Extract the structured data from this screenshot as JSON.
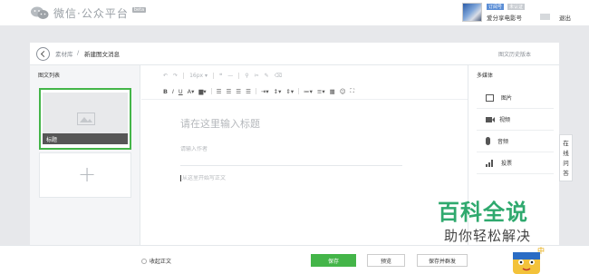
{
  "header": {
    "logo_icon": "wechat-bubbles-icon",
    "title": "微信·公众平台",
    "beta": "beta",
    "account": {
      "badge_primary": "订阅号",
      "badge_secondary": "未认证",
      "name": "爱分享电影号",
      "logout": "退出"
    }
  },
  "breadcrumb": {
    "library": "素材库",
    "separator": "/",
    "current": "新建图文消息",
    "history": "图文历史版本"
  },
  "article_list": {
    "title": "图文列表",
    "card_title": "标题",
    "add_symbol": "+"
  },
  "toolbar": {
    "font_size": "16px",
    "row1_icons": [
      "undo-icon",
      "redo-icon",
      "font-size-select",
      "quote-icon",
      "divider-icon",
      "link-icon",
      "unlink-icon",
      "format-brush-icon",
      "clear-format-icon"
    ],
    "row2_icons": [
      "bold-icon",
      "italic-icon",
      "underline-icon",
      "font-color-icon",
      "background-color-icon",
      "align-left-icon",
      "align-center-icon",
      "align-right-icon",
      "align-justify-icon",
      "indent-icon",
      "line-height-icon",
      "paragraph-spacing-icon",
      "ordered-list-icon",
      "unordered-list-icon",
      "table-icon",
      "emoji-icon",
      "fullscreen-icon"
    ]
  },
  "editor": {
    "title_placeholder": "请在这里输入标题",
    "author_placeholder": "请输入作者",
    "body_placeholder": "从这里开始写正文"
  },
  "media": {
    "title": "多媒体",
    "items": [
      {
        "icon": "image-icon",
        "label": "图片"
      },
      {
        "icon": "video-icon",
        "label": "视频"
      },
      {
        "icon": "audio-icon",
        "label": "音频"
      },
      {
        "icon": "vote-icon",
        "label": "投票"
      }
    ]
  },
  "online_help": [
    "在",
    "线",
    "问",
    "答"
  ],
  "footer": {
    "collapse_label": "收起正文",
    "save": "保存",
    "preview": "预览",
    "save_and_send": "保存并群发"
  },
  "watermark": {
    "title": "百科全说",
    "subtitle": "助你轻松解决"
  },
  "colors": {
    "accent_green": "#44b549",
    "page_gray": "#e7e8eb",
    "watermark_green": "#2fa96e"
  }
}
